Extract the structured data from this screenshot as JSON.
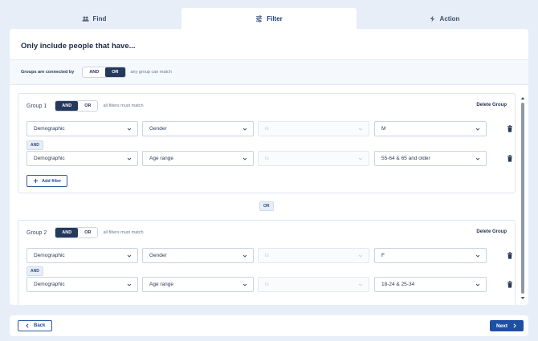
{
  "tabs": [
    {
      "label": "Find",
      "icon": "group-icon",
      "active": false
    },
    {
      "label": "Filter",
      "icon": "sliders-icon",
      "active": true
    },
    {
      "label": "Action",
      "icon": "lightning-icon",
      "active": false
    }
  ],
  "main": {
    "title": "Only include people that have...",
    "connector": {
      "label": "Groups are connected by",
      "options": [
        "AND",
        "OR"
      ],
      "selected": "OR",
      "hint": "any group can match"
    },
    "between_groups": "OR",
    "groups": [
      {
        "label": "Group 1",
        "options": [
          "AND",
          "OR"
        ],
        "selected": "AND",
        "hint": "all filters must match",
        "delete_label": "Delete Group",
        "joiner": "AND",
        "add_filter_label": "Add filter",
        "filters": [
          {
            "category": "Demographic",
            "field": "Gender",
            "operator": "is",
            "value": "M"
          },
          {
            "category": "Demographic",
            "field": "Age range",
            "operator": "is",
            "value": "55-64 & 65 and older"
          }
        ]
      },
      {
        "label": "Group 2",
        "options": [
          "AND",
          "OR"
        ],
        "selected": "AND",
        "hint": "all filters must match",
        "delete_label": "Delete Group",
        "joiner": "AND",
        "filters": [
          {
            "category": "Demographic",
            "field": "Gender",
            "operator": "is",
            "value": "F"
          },
          {
            "category": "Demographic",
            "field": "Age range",
            "operator": "is",
            "value": "18-24 & 25-34"
          }
        ]
      }
    ]
  },
  "footer": {
    "back_label": "Back",
    "next_label": "Next"
  },
  "colors": {
    "accent": "#1f4fa3",
    "toggle_on": "#25395c",
    "background": "#e7eef7"
  }
}
